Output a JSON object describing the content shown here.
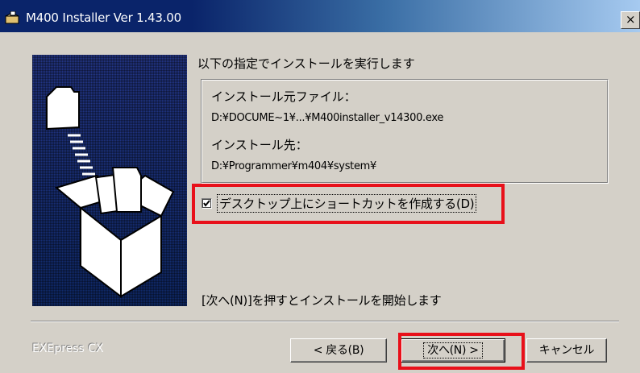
{
  "window": {
    "title": "M400 Installer Ver 1.43.00",
    "close_label": "×"
  },
  "main": {
    "heading": "以下の指定でインストールを実行します",
    "source_label": "インストール元ファイル：",
    "source_value": "D:¥DOCUME~1¥...¥M400installer_v14300.exe",
    "dest_label": "インストール先：",
    "dest_value": "D:¥Programmer¥m404¥system¥",
    "checkbox": {
      "label": "デスクトップ上にショートカットを作成する(D)",
      "checked": true
    },
    "footer_text": "[次へ(N)]を押すとインストールを開始します"
  },
  "footer": {
    "brand": "EXEpress CX",
    "back_label": "< 戻る(B)",
    "next_label": "次へ(N) >",
    "cancel_label": "キャンセル"
  },
  "colors": {
    "title_bar": "#0a246a",
    "highlight": "#e8101a",
    "dialog_bg": "#d4d0c8"
  }
}
